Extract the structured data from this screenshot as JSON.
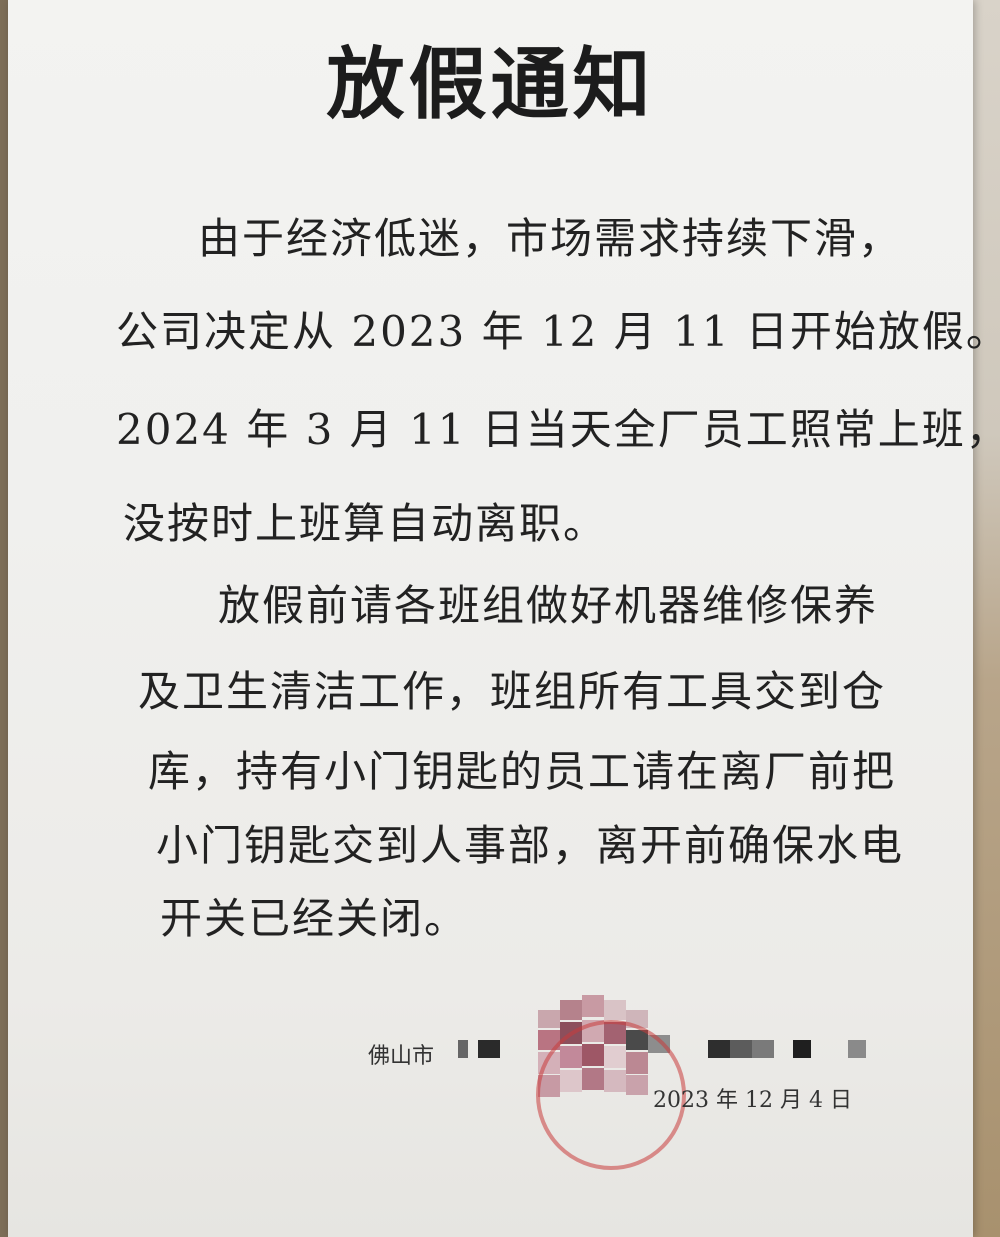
{
  "notice": {
    "title": "放假通知",
    "paragraph1": [
      "由于经济低迷，市场需求持续下滑，",
      "公司决定从 2023 年 12 月 11 日开始放假。",
      "2024 年 3 月 11 日当天全厂员工照常上班，",
      "没按时上班算自动离职。"
    ],
    "paragraph2": [
      "放假前请各班组做好机器维修保养",
      "及卫生清洁工作，班组所有工具交到仓",
      "库，持有小门钥匙的员工请在离厂前把",
      "小门钥匙交到人事部，离开前确保水电",
      "开关已经关闭。"
    ],
    "signature": {
      "company_prefix": "佛山市",
      "date": "2023 年 12 月 4 日"
    }
  },
  "colors": {
    "paper": "#f0f0ee",
    "text": "#222222",
    "stamp": "#c83c3c"
  }
}
